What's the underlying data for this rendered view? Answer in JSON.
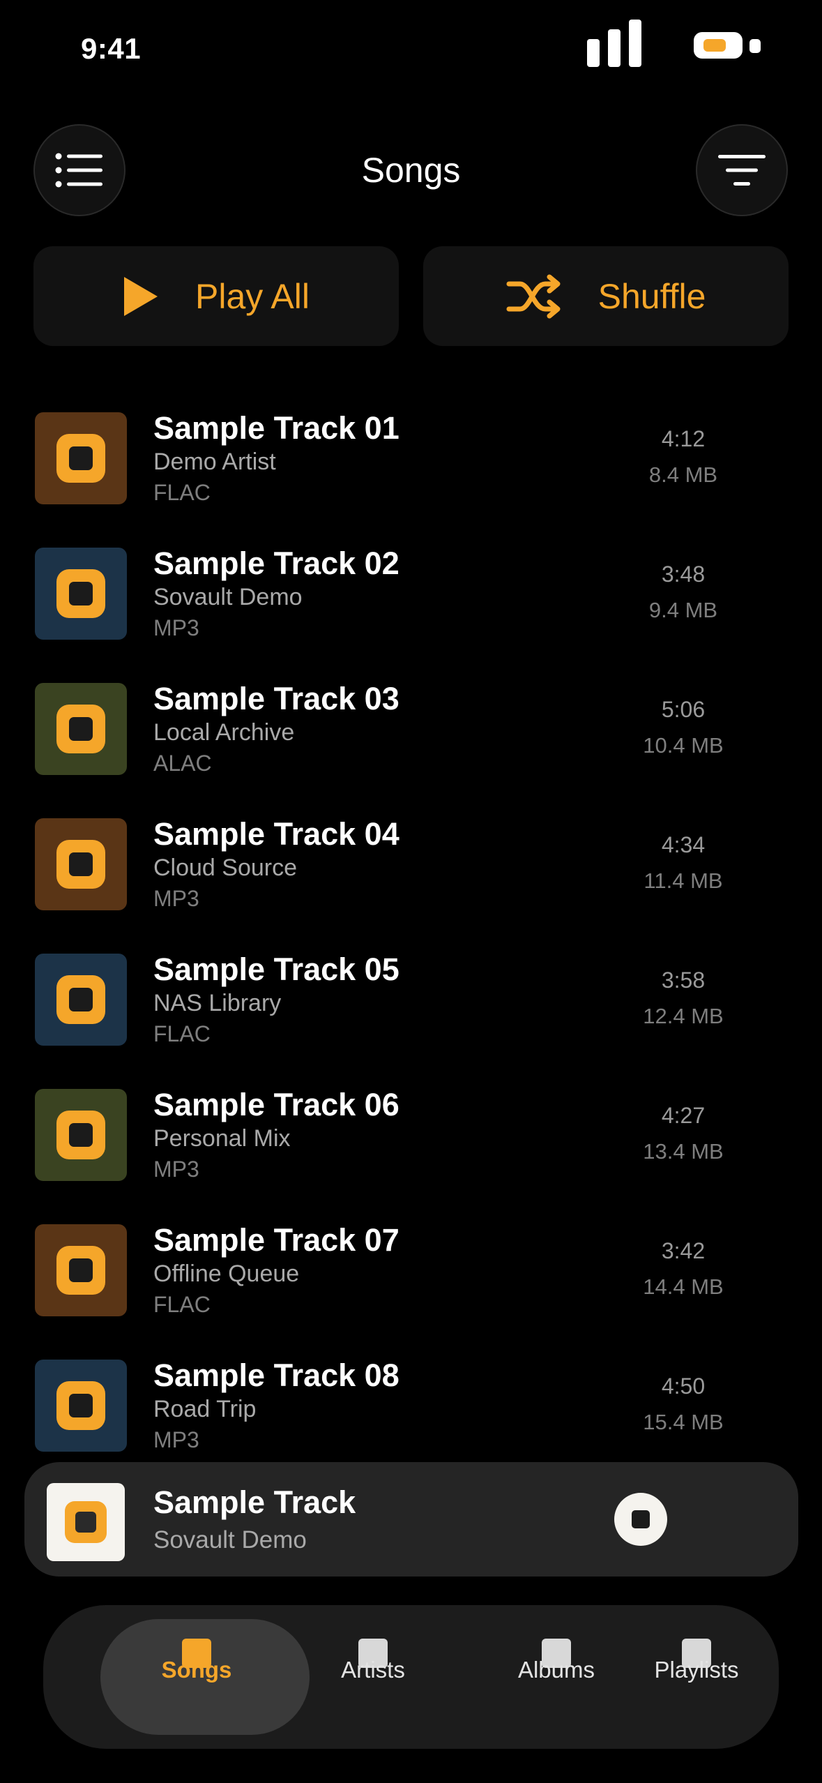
{
  "status_bar": {
    "time": "9:41"
  },
  "header": {
    "title": "Songs",
    "menu_icon": "list-icon",
    "sort_icon": "filter-icon"
  },
  "actions": {
    "play_all_label": "Play All",
    "shuffle_label": "Shuffle",
    "play_icon": "play-icon",
    "shuffle_icon": "shuffle-icon"
  },
  "colors": {
    "accent": "#f5a62a",
    "background": "#000000",
    "art_brown": "#5a3516",
    "art_blue": "#1c3348",
    "art_olive": "#3a4321"
  },
  "songs": [
    {
      "title": "Sample Track 01",
      "artist": "Demo Artist",
      "format": "FLAC",
      "duration": "4:12",
      "size": "8.4 MB",
      "art_color": "#5a3516"
    },
    {
      "title": "Sample Track 02",
      "artist": "Sovault Demo",
      "format": "MP3",
      "duration": "3:48",
      "size": "9.4 MB",
      "art_color": "#1c3348"
    },
    {
      "title": "Sample Track 03",
      "artist": "Local Archive",
      "format": "ALAC",
      "duration": "5:06",
      "size": "10.4 MB",
      "art_color": "#3a4321"
    },
    {
      "title": "Sample Track 04",
      "artist": "Cloud Source",
      "format": "MP3",
      "duration": "4:34",
      "size": "11.4 MB",
      "art_color": "#5a3516"
    },
    {
      "title": "Sample Track 05",
      "artist": "NAS Library",
      "format": "FLAC",
      "duration": "3:58",
      "size": "12.4 MB",
      "art_color": "#1c3348"
    },
    {
      "title": "Sample Track 06",
      "artist": "Personal Mix",
      "format": "MP3",
      "duration": "4:27",
      "size": "13.4 MB",
      "art_color": "#3a4321"
    },
    {
      "title": "Sample Track 07",
      "artist": "Offline Queue",
      "format": "FLAC",
      "duration": "3:42",
      "size": "14.4 MB",
      "art_color": "#5a3516"
    },
    {
      "title": "Sample Track 08",
      "artist": "Road Trip",
      "format": "MP3",
      "duration": "4:50",
      "size": "15.4 MB",
      "art_color": "#1c3348"
    }
  ],
  "mini_player": {
    "title": "Sample Track",
    "artist": "Sovault Demo",
    "control_icon": "stop-icon"
  },
  "tabs": [
    {
      "label": "Songs",
      "active": true
    },
    {
      "label": "Artists",
      "active": false
    },
    {
      "label": "Albums",
      "active": false
    },
    {
      "label": "Playlists",
      "active": false
    }
  ]
}
